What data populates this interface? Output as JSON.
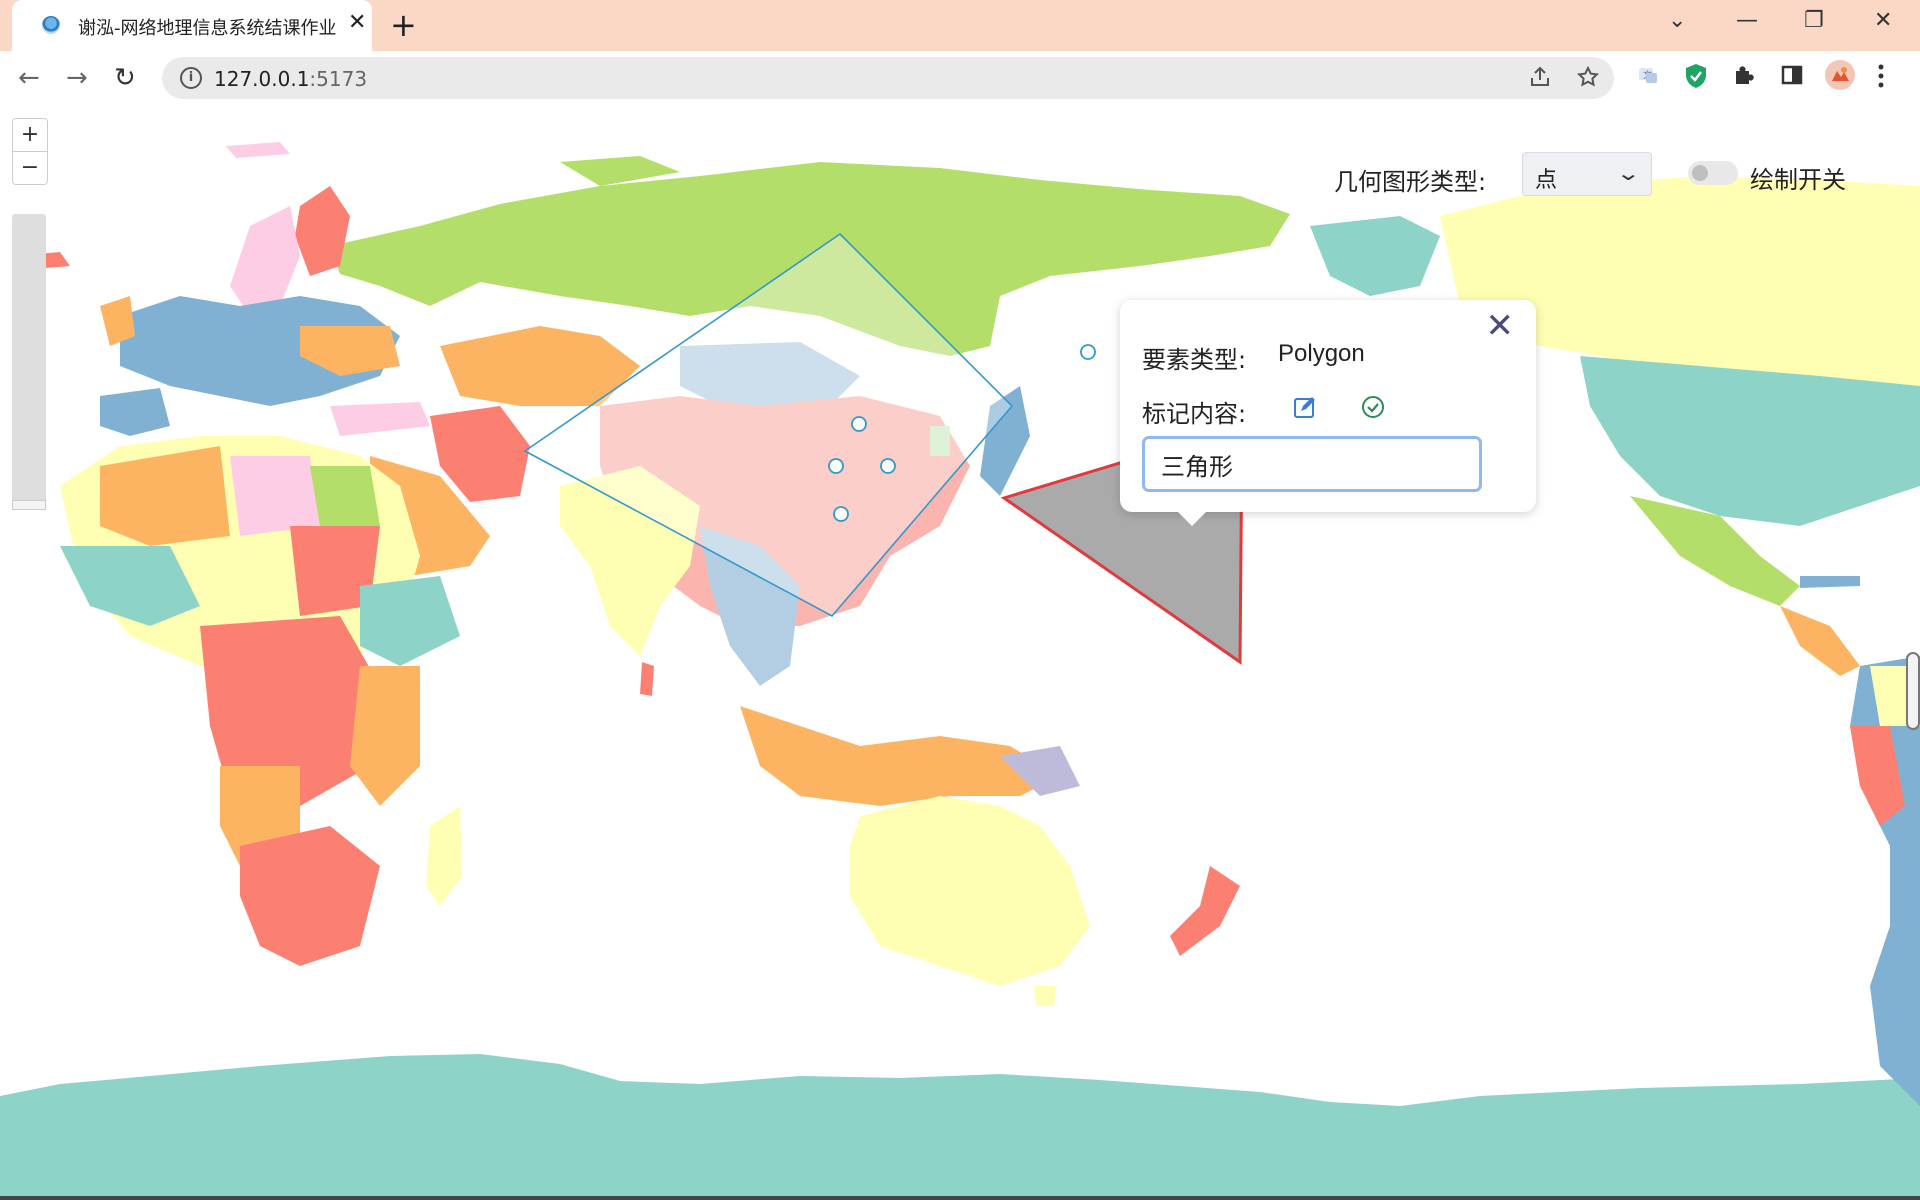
{
  "browser": {
    "tab_title": "谢泓-网络地理信息系统结课作业",
    "tab_close": "✕",
    "new_tab": "+",
    "url_host": "127.0.0.1",
    "url_port": ":5173",
    "window_controls": {
      "dropdown": "⌄",
      "minimize": "—",
      "restore": "❐",
      "close": "✕"
    },
    "nav": {
      "back": "←",
      "forward": "→",
      "reload": "↻"
    },
    "icons": [
      "share-icon",
      "star-icon",
      "translate-extension-icon",
      "shield-extension-icon",
      "puzzle-extension-icon",
      "sidepanel-icon",
      "profile-avatar",
      "menu-icon"
    ]
  },
  "map_controls": {
    "zoom_in": "+",
    "zoom_out": "−",
    "geometry_type_label": "几何图形类型:",
    "geometry_type_value": "点",
    "draw_switch_label": "绘制开关",
    "draw_switch_on": false
  },
  "popup": {
    "close": "✕",
    "feature_type_label": "要素类型:",
    "feature_type_value": "Polygon",
    "mark_content_label": "标记内容:",
    "mark_input_value": "三角形"
  },
  "colors": {
    "tabstrip": "#fbd8c6",
    "ocean": "#ffffff",
    "antarctica": "#8dd3c7",
    "triangle_fill": "#aaaaaa",
    "triangle_stroke": "#e0393e",
    "rectangle_stroke": "#3399cc",
    "point_stroke": "#3399cc",
    "country_palette": [
      "#8dd3c7",
      "#ffffb3",
      "#bebada",
      "#fb8072",
      "#80b1d3",
      "#fdb462",
      "#b3de69",
      "#fccde5",
      "#d9d9d9"
    ]
  }
}
